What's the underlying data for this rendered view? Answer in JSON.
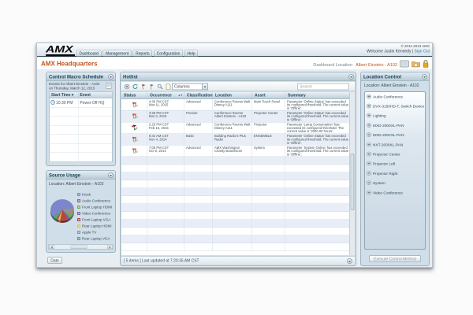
{
  "window": {
    "copyright": "© 2011-2013 AMX",
    "welcome": "Welcome Justin Kennedy",
    "sign_out_label": "Sign Out",
    "logo_text": "AMX",
    "tabs": [
      "Dashboard",
      "Management",
      "Reports",
      "Configuration",
      "Help"
    ],
    "page_title": "AMX Headquarters",
    "dashboard_location_label": "Dashboard Location:",
    "dashboard_location_value": "Albert Einstein - A102"
  },
  "schedule_panel": {
    "title": "Control Macro Schedule",
    "intro_line1": "Events for Albert Einstein - A102",
    "intro_line2": "on Thursday, March 12, 2015",
    "columns": [
      "Start Time",
      "Event"
    ],
    "rows": [
      {
        "start_time": "10:30 PM",
        "event": "Power Off HQ"
      }
    ],
    "empty_row_count": 7
  },
  "source_usage_panel": {
    "title": "Source Usage",
    "location_line": "Location:   Albert Einstein - A102",
    "date_button_label": "Date"
  },
  "chart_data": {
    "type": "pie",
    "title": "Source Usage",
    "slices": [
      {
        "label": "Kiosk",
        "value": 57,
        "color": "#7d86cc"
      },
      {
        "label": "Audio Conference",
        "value": 3,
        "color": "#c0504d"
      },
      {
        "label": "Front Laptop HDMI",
        "value": 5,
        "color": "#6fae4e"
      },
      {
        "label": "Video Conference",
        "value": 4,
        "color": "#8064a2"
      },
      {
        "label": "Front Laptop VGA",
        "value": 12,
        "color": "#b94441"
      },
      {
        "label": "Rear Laptop HDMI",
        "value": 3,
        "color": "#e3c93f"
      },
      {
        "label": "Apple TV",
        "value": 10,
        "color": "#98908c"
      },
      {
        "label": "Rear Laptop VGA",
        "value": 6,
        "color": "#55a07c"
      }
    ],
    "legend_position": "right",
    "start_angle_deg": 235,
    "pie_display_order": [
      0,
      6,
      2,
      3,
      4,
      5,
      1,
      7
    ]
  },
  "hotlist_panel": {
    "title": "Hotlist",
    "columns_dropdown_label": "Columns",
    "search_placeholder": "Search",
    "columns": [
      "Status",
      "Occurrence",
      "Classification",
      "Location",
      "Asset",
      "Summary"
    ],
    "rows": [
      {
        "status_icon": "red-flags-icon",
        "time": "4:30 PM CST",
        "date": "Mar 11, 2015",
        "classification": "Advanced",
        "location": "Conference Rooms Walt Disney A111",
        "asset": "Main Touch Panel",
        "summary": "Parameter 'Online Status' has exceeded its configured threshold.  The current value is 'Offline'."
      },
      {
        "status_icon": "red-flags-icon",
        "time": "3:39 PM CST",
        "date": "Mar 3, 2015",
        "classification": "Premier",
        "location": "Conference Rooms Albert Einstein - A102",
        "asset": "Projector Center",
        "summary": "Parameter 'Online Status' has exceeded its configured threshold.  The current value is 'Offline'."
      },
      {
        "status_icon": "black-flag-check-icon",
        "time": "2:20 PM CST",
        "date": "Feb 16, 2015",
        "classification": "Advanced",
        "location": "Conference Rooms Walt Disney A111",
        "asset": "Projector",
        "summary": "Parameter 'Lamp Consumption' has exceeded its configured threshold.  The current value is '2000.00 hours'."
      },
      {
        "status_icon": "red-flags-icon",
        "time": "8:42 AM CST",
        "date": "Nov 4, 2014",
        "classification": "Basic",
        "location": "Building Radio 5 Plus Radio",
        "asset": "ENSEMBLE",
        "summary": "Parameter 'Online Status' has exceeded its configured threshold.  The current value is 'Offline'."
      },
      {
        "status_icon": "red-flags-icon",
        "time": "7:08 PM CST",
        "date": "Oct 9, 2014",
        "classification": "Advanced",
        "location": "AMX Washington Charity Boardroom",
        "asset": "System",
        "summary": "Parameter 'System Online' has exceeded its configured threshold.  The current value is 'Offline'."
      }
    ],
    "empty_row_count": 12,
    "status_bar": "[ 5 items ]  Last updated at 7:20:35 AM CST"
  },
  "location_control_panel": {
    "title": "Location Control",
    "location_line": "Location:   Albert Einstein - A102",
    "devices": [
      "Audio Conference",
      "DVX-3150HD-T, Switch Device",
      "Lighting",
      "MXD-2000XL-PAN",
      "MXD-2002XL-PAN",
      "NXT-2000XL-PAN",
      "Projector Center",
      "Projector Left",
      "Projector Right",
      "System",
      "Video Conference"
    ],
    "execute_button_label": "Execute Control Method"
  }
}
